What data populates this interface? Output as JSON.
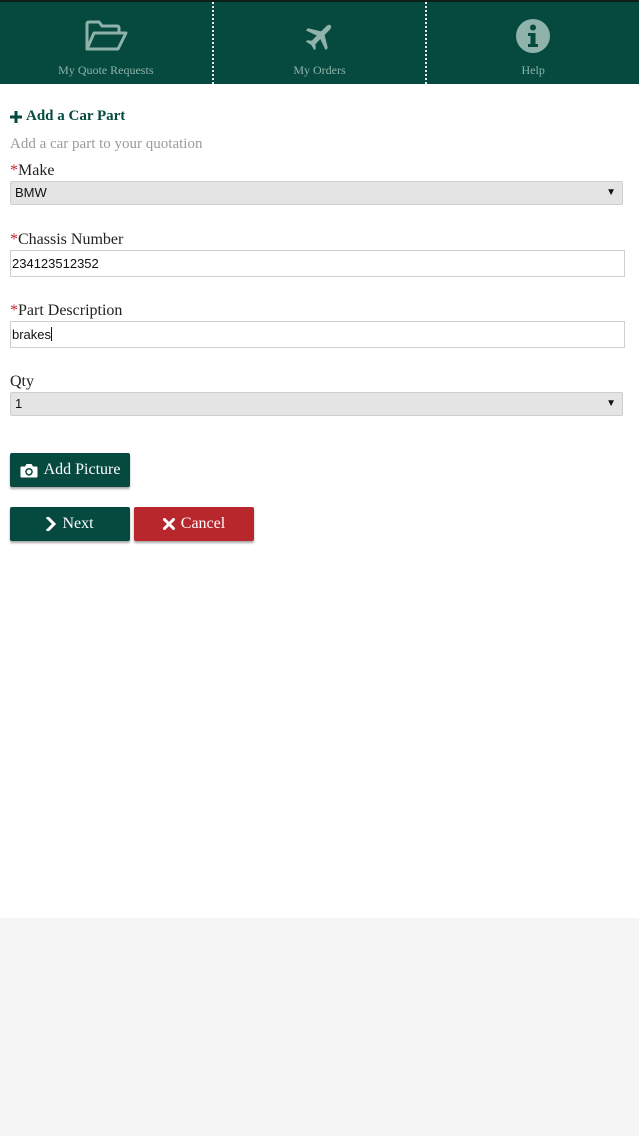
{
  "nav": {
    "items": [
      {
        "label": "My Quote Requests",
        "icon": "folder-open-icon"
      },
      {
        "label": "My Orders",
        "icon": "plane-icon"
      },
      {
        "label": "Help",
        "icon": "info-icon"
      }
    ]
  },
  "form": {
    "title": "Add a Car Part",
    "subtitle": "Add a car part to your quotation",
    "required_marker": "*",
    "make": {
      "label": "Make",
      "value": "BMW"
    },
    "chassis": {
      "label": "Chassis Number",
      "value": "234123512352"
    },
    "description": {
      "label": "Part Description",
      "value": "brakes"
    },
    "qty": {
      "label": "Qty",
      "value": "1"
    }
  },
  "buttons": {
    "add_picture": "Add Picture",
    "next": "Next",
    "cancel": "Cancel"
  },
  "colors": {
    "primary": "#064a3f",
    "danger": "#b8272c",
    "required": "#c0272d"
  }
}
